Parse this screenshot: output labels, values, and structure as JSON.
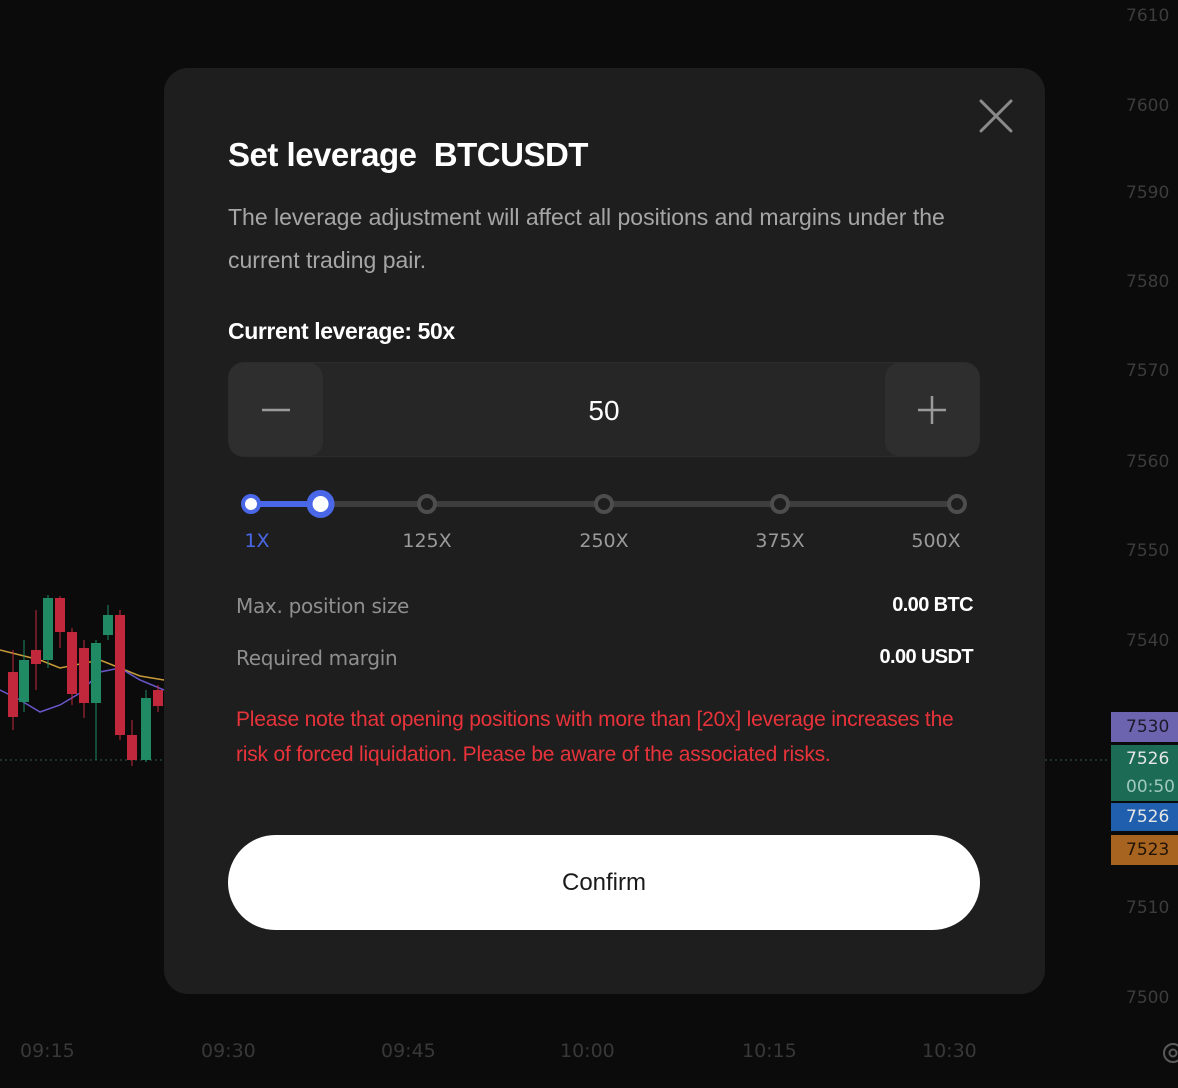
{
  "modal": {
    "title": "Set leverage  BTCUSDT",
    "description": "The leverage adjustment will affect all positions and margins under the current trading pair.",
    "current_leverage_label": "Current leverage: 50x",
    "stepper": {
      "value": "50"
    },
    "slider": {
      "marks": [
        "1X",
        "125X",
        "250X",
        "375X",
        "500X"
      ],
      "min": 1,
      "max": 500,
      "value": 50
    },
    "info": [
      {
        "label": "Max. position size",
        "value": "0.00 BTC"
      },
      {
        "label": "Required margin",
        "value": "0.00 USDT"
      }
    ],
    "warning": "Please note that opening positions with more than [20x] leverage increases the risk of forced liquidation. Please be aware of the associated risks.",
    "confirm_label": "Confirm"
  },
  "chart": {
    "price_axis": [
      "7610",
      "7600",
      "7590",
      "7580",
      "7570",
      "7560",
      "7550",
      "7540",
      "7510",
      "7500"
    ],
    "time_axis": [
      "09:15",
      "09:30",
      "09:45",
      "10:00",
      "10:15",
      "10:30"
    ],
    "price_tags": [
      "7530",
      "7526",
      "00:50",
      "7526",
      "7523"
    ]
  },
  "colors": {
    "accent": "#4a67e8",
    "warning": "#e8333a",
    "modal_bg": "#1e1e1e",
    "candle_up": "#1f8a63",
    "candle_down": "#c2283c"
  }
}
